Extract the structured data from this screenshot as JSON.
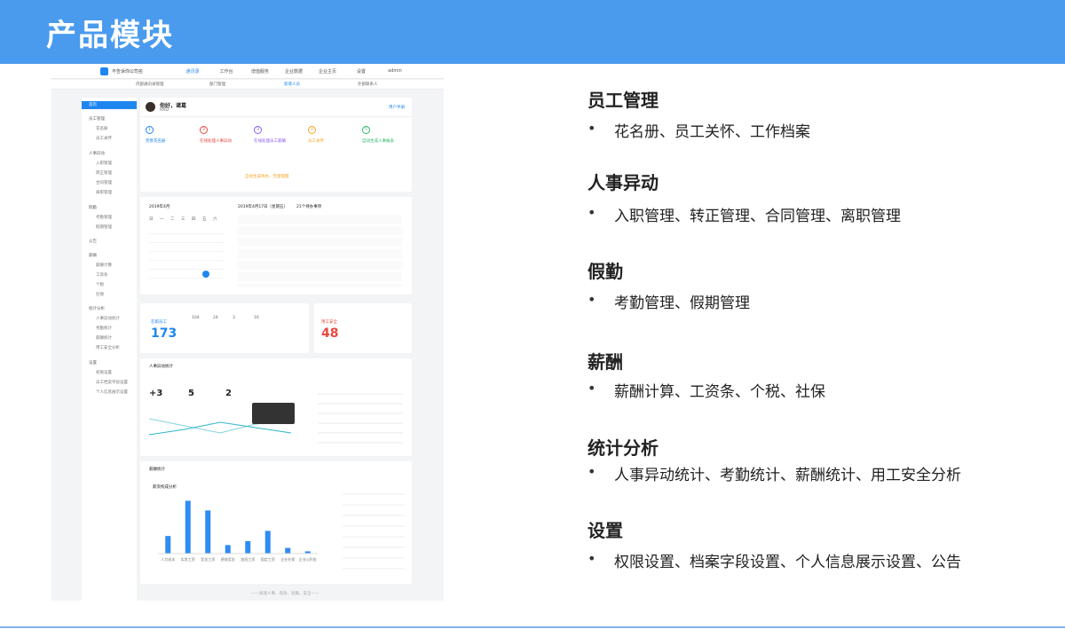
{
  "slide": {
    "title": "产品模块"
  },
  "app": {
    "company": "不告诉你公司名",
    "nav": [
      "通讯录",
      "工作台",
      "增值服务",
      "企业数据",
      "企业主页",
      "设置",
      "admin"
    ],
    "subnav": [
      "内部通讯录管理",
      "部门管理",
      "新增人员",
      "外部联系人"
    ],
    "sidebar": [
      "首页",
      "员工管理",
      "花名册",
      "员工关怀",
      "人事异动",
      "入职管理",
      "转正管理",
      "合同管理",
      "离职管理",
      "假勤",
      "考勤管理",
      "假期管理",
      "公告",
      "薪酬",
      "薪酬计算",
      "工资条",
      "个税",
      "社保",
      "统计分析",
      "人事异动统计",
      "考勤统计",
      "薪酬统计",
      "用工安全分析",
      "设置",
      "权限设置",
      "员工档案字段设置",
      "个人信息展示设置"
    ],
    "greeting": "你好，诸葛",
    "greeting_sub": "HRD",
    "help": "用户手册",
    "steps": [
      {
        "num": "1",
        "title": "完善花名册"
      },
      {
        "num": "2",
        "title": "在线处理人事异动"
      },
      {
        "num": "3",
        "title": "在线处理员工薪酬"
      },
      {
        "num": "4",
        "title": "员工关怀"
      },
      {
        "num": "5",
        "title": "自动生成人事报表"
      }
    ],
    "reminder": "自动生成待办，无需提醒",
    "calendar_title": "2019年4月",
    "weekdays": [
      "日",
      "一",
      "二",
      "三",
      "四",
      "五",
      "六"
    ],
    "todo_title": "2019年4月17日（星期五）",
    "todo_count": "21个待办事项",
    "stats": {
      "label": "在职员工",
      "total": "173",
      "full": "104",
      "trial": "24",
      "intern": "3",
      "other": "16",
      "risk_label": "用工安全",
      "risk": "48"
    },
    "change_title": "人事异动统计",
    "change_net": "+3",
    "change_in": "5",
    "change_out": "2",
    "pay_title": "薪酬统计",
    "pay_chart_label": "薪资构成分析",
    "pay_categories": [
      "人力成本",
      "实发工资",
      "奖金工资",
      "绩效奖金",
      "加班工资",
      "固定工资",
      "企业社保",
      "企业公积金"
    ],
    "pay_values": [
      3100,
      9300,
      7600,
      1500,
      2200,
      4000,
      1000,
      400
    ],
    "footer": "——加速人事、高效、准确、安全——"
  },
  "modules": [
    {
      "title": "员工管理",
      "items": "花名册、员工关怀、工作档案"
    },
    {
      "title": "人事异动",
      "items": "入职管理、转正管理、合同管理、离职管理"
    },
    {
      "title": "假勤",
      "items": "考勤管理、假期管理"
    },
    {
      "title": "薪酬",
      "items": "薪酬计算、工资条、个税、社保"
    },
    {
      "title": "统计分析",
      "items": "人事异动统计、考勤统计、薪酬统计、用工安全分析"
    },
    {
      "title": "设置",
      "items": "权限设置、档案字段设置、个人信息展示设置、公告"
    }
  ],
  "bullet": "•",
  "colors": {
    "header": "#4a9bee",
    "accent": "#1f86f0"
  }
}
